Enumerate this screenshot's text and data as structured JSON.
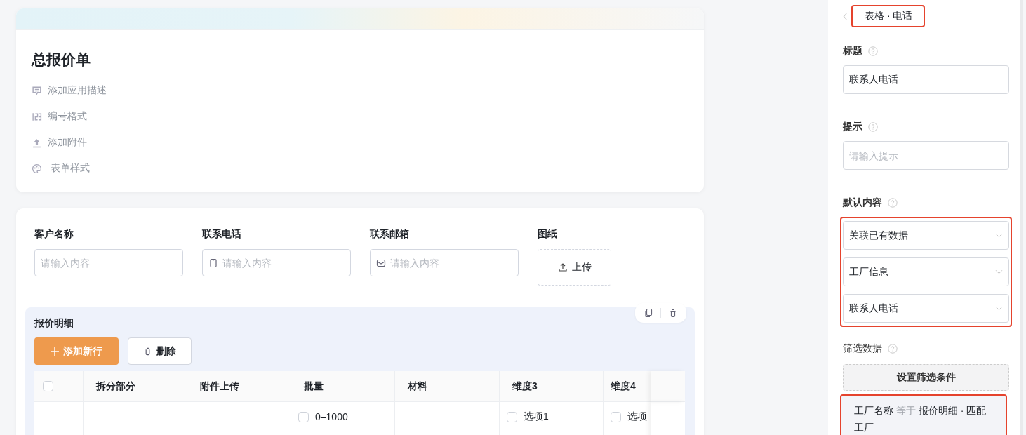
{
  "form_header": {
    "title": "总报价单",
    "actions": [
      {
        "label": "添加应用描述",
        "kind": "description"
      },
      {
        "label": "编号格式",
        "kind": "numbering"
      },
      {
        "label": "添加附件",
        "kind": "attachment"
      },
      {
        "label": "表单样式",
        "kind": "style"
      }
    ]
  },
  "fields": [
    {
      "label": "客户名称",
      "kind": "text",
      "placeholder": "请输入内容"
    },
    {
      "label": "联系电话",
      "kind": "phone",
      "placeholder": "请输入内容"
    },
    {
      "label": "联系邮箱",
      "kind": "email",
      "placeholder": "请输入内容"
    },
    {
      "label": "图纸",
      "kind": "upload",
      "button": "上传"
    }
  ],
  "subtable": {
    "title": "报价明细",
    "buttons": [
      {
        "label": "添加新行",
        "kind": "add"
      },
      {
        "label": "删除",
        "kind": "delete"
      }
    ],
    "header_checked": false,
    "columns": [
      "拆分部分",
      "附件上传",
      "批量",
      "材料",
      "维度3",
      "维度4"
    ],
    "rows": [
      {
        "cells": [
          [],
          [],
          [
            {
              "label": "0–1000",
              "checked": false
            }
          ],
          [],
          [
            {
              "label": "选项1",
              "checked": false
            }
          ],
          [
            {
              "label": "选项",
              "checked": false
            }
          ]
        ]
      }
    ]
  },
  "panel": {
    "breadcrumb": {
      "label": "表格 · 电话",
      "highlighted": true
    },
    "title_field": {
      "label": "标题",
      "value": "联系人电话"
    },
    "hint_field": {
      "label": "提示",
      "placeholder": "请输入提示"
    },
    "default_content": {
      "label": "默认内容",
      "highlighted": true,
      "selects": [
        "关联已有数据",
        "工厂信息",
        "联系人电话"
      ]
    },
    "filter": {
      "label": "筛选数据",
      "button": "设置筛选条件",
      "condition": {
        "field": "工厂名称",
        "operator": "等于",
        "value": "报价明细 · 匹配工厂",
        "highlighted": true
      }
    }
  }
}
